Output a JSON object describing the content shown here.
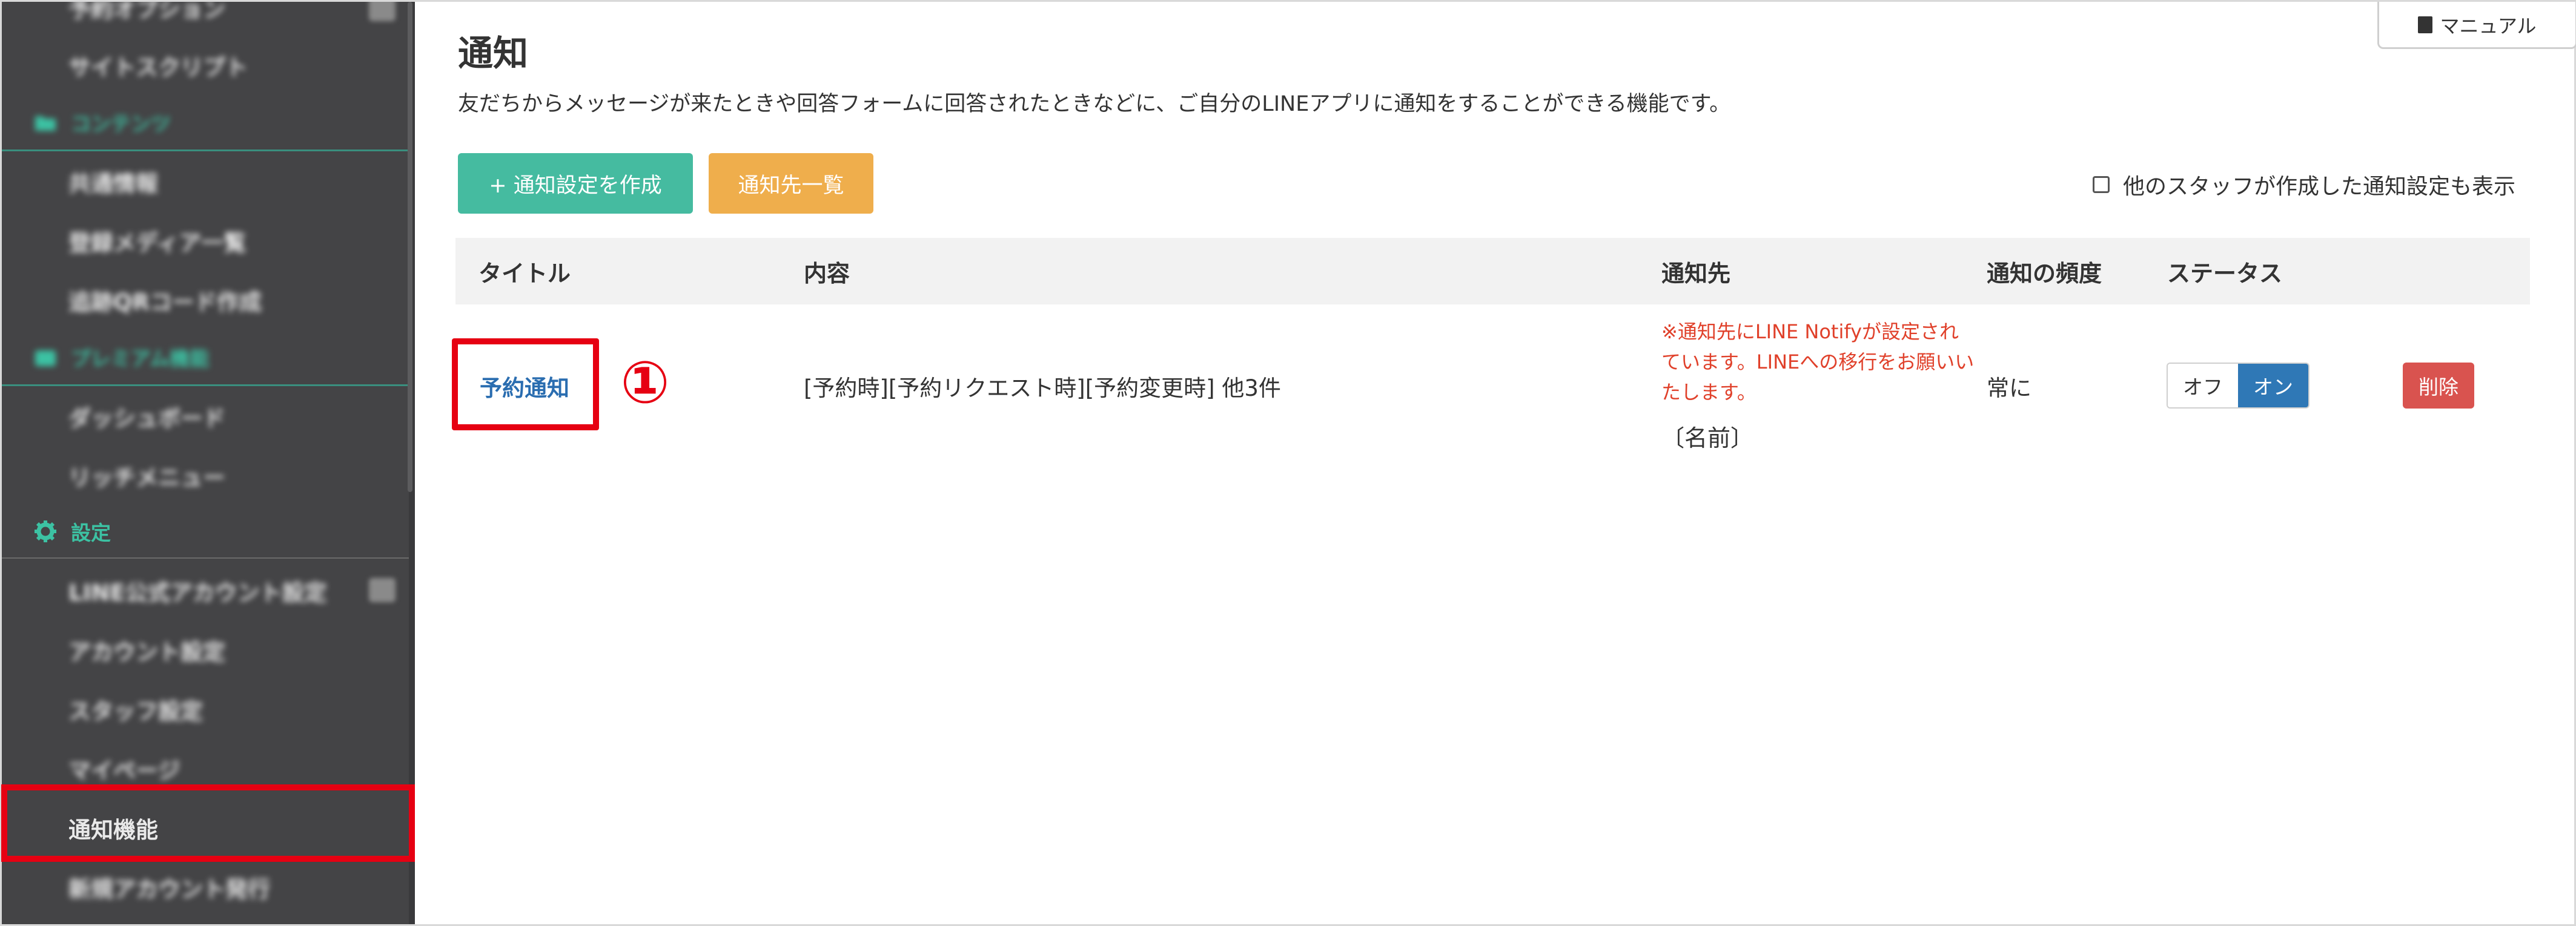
{
  "sidebar": {
    "items": [
      {
        "label": "予約オプション",
        "blurred": true
      },
      {
        "label": "サイトスクリプト",
        "blurred": true
      },
      {
        "label": "共通情報",
        "blurred": true
      },
      {
        "label": "登録メディア一覧",
        "blurred": true
      },
      {
        "label": "追跡QRコード作成",
        "blurred": true
      },
      {
        "label": "ダッシュボード",
        "blurred": true
      },
      {
        "label": "リッチメニュー",
        "blurred": true
      },
      {
        "label": "LINE公式アカウント設定",
        "blurred": true
      },
      {
        "label": "アカウント設定",
        "blurred": true
      },
      {
        "label": "スタッフ設定",
        "blurred": true
      },
      {
        "label": "マイページ",
        "blurred": true
      },
      {
        "label": "通知機能",
        "blurred": false
      },
      {
        "label": "新規アカウント発行",
        "blurred": true
      }
    ],
    "sections": {
      "contents": "コンテンツ",
      "premium": "プレミアム機能",
      "settings": "設定"
    }
  },
  "main": {
    "title": "通知",
    "description": "友だちからメッセージが来たときや回答フォームに回答されたときなどに、ご自分のLINEアプリに通知をすることができる機能です。",
    "manual_label": "マニュアル",
    "create_button": "+ 通知設定を作成",
    "destination_list_button": "通知先一覧",
    "show_others_label": "他のスタッフが作成した通知設定も表示",
    "table": {
      "headers": {
        "title": "タイトル",
        "content": "内容",
        "destination": "通知先",
        "frequency": "通知の頻度",
        "status": "ステータス"
      },
      "rows": [
        {
          "title": "予約通知",
          "content": "[予約時][予約リクエスト時][予約変更時] 他3件",
          "warning": "※通知先にLINE Notifyが設定されています。LINEへの移行をお願いいたします。",
          "destination": "〔名前〕",
          "frequency": "常に",
          "status_off": "オフ",
          "status_on": "オン",
          "delete": "削除"
        }
      ]
    }
  },
  "annotation": {
    "marker": "①",
    "color": "#e60012"
  },
  "colors": {
    "sidebar_bg": "#444446",
    "accent_green": "#45bba0",
    "accent_orange": "#efae4c",
    "status_on_blue": "#2f78b6",
    "delete_red": "#d9534f",
    "warning_red": "#e0402a",
    "link_blue": "#2a6db0"
  }
}
